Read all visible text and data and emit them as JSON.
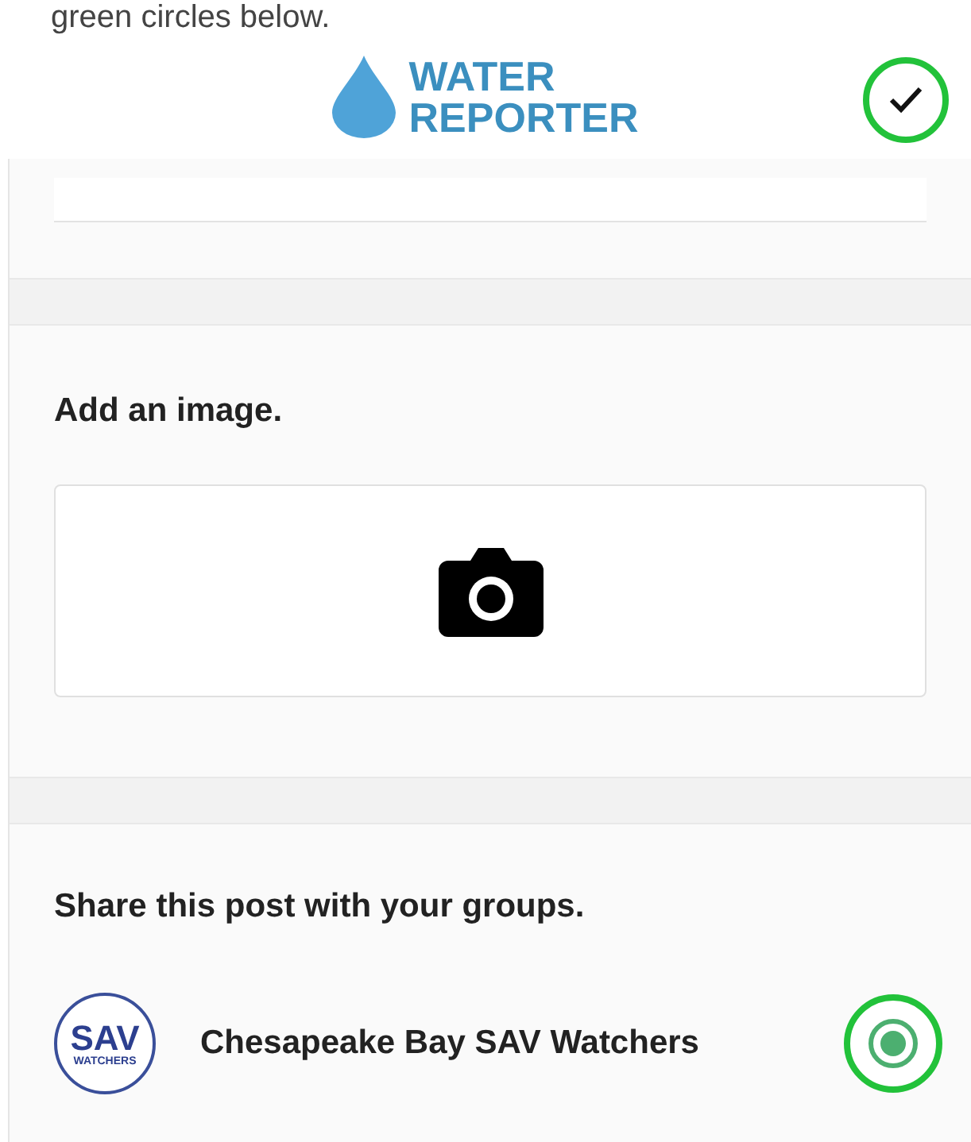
{
  "caption": "green circles below.",
  "header": {
    "logo_line_1": "WATER",
    "logo_line_2": "REPORTER"
  },
  "image_section": {
    "heading": "Add an image."
  },
  "groups_section": {
    "heading": "Share this post with your groups.",
    "groups": [
      {
        "name": "Chesapeake Bay SAV Watchers",
        "avatar_label": "SAV",
        "avatar_sublabel": "WATCHERS",
        "selected": true
      }
    ]
  }
}
